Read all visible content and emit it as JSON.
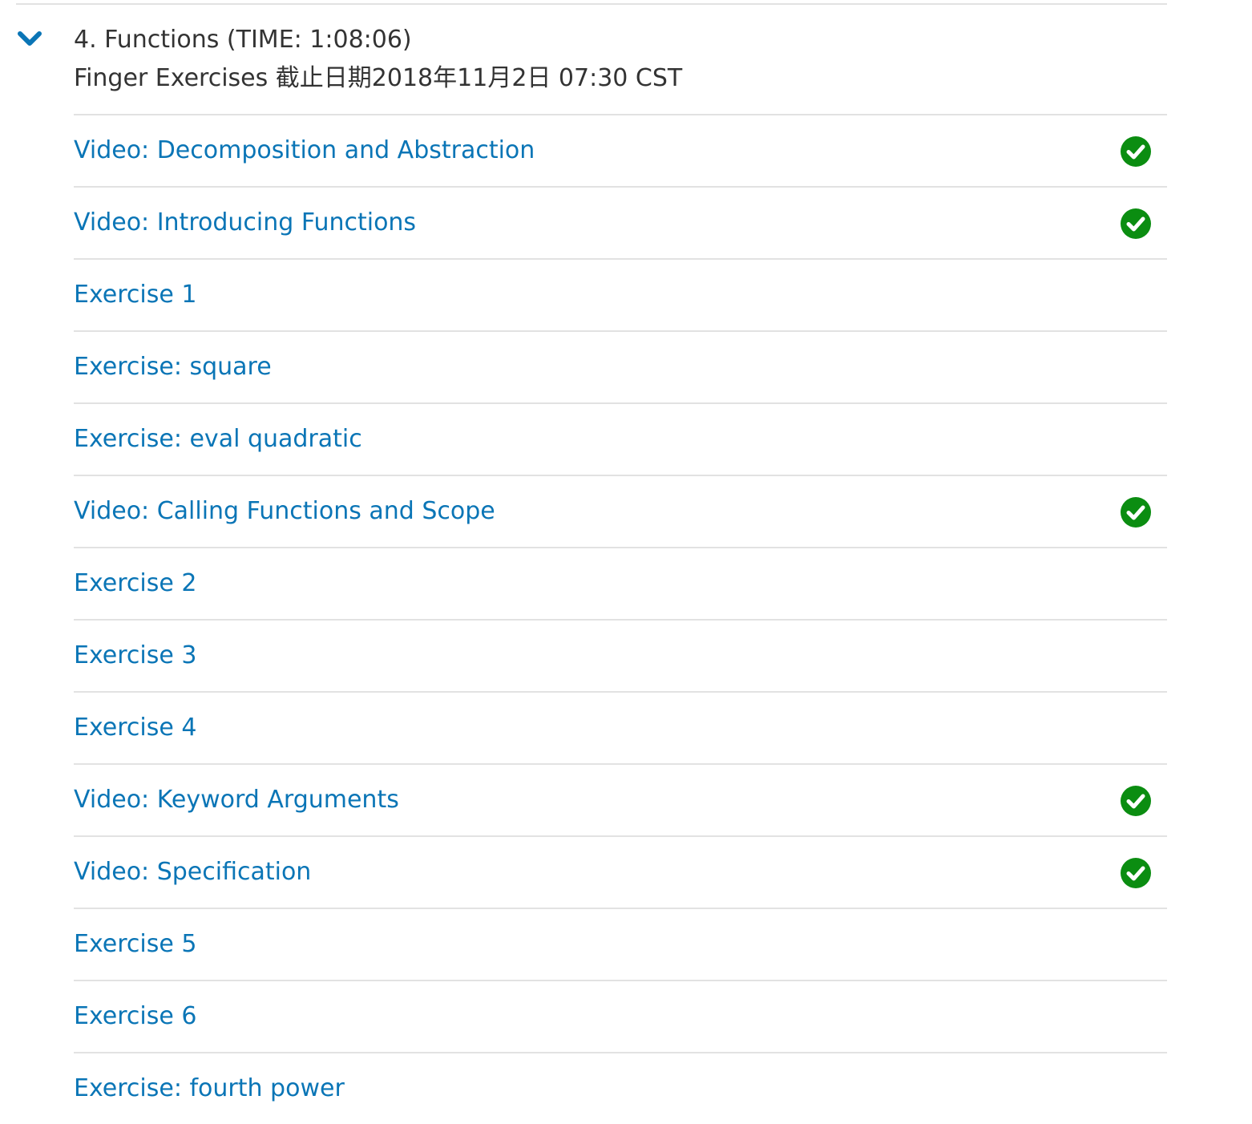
{
  "section": {
    "title": "4. Functions (TIME: 1:08:06)",
    "subtitle": "Finger Exercises 截止日期2018年11月2日 07:30 CST",
    "toggle_icon": "chevron-down-icon",
    "accent_color": "#0a75b6",
    "complete_color": "#0b8d11"
  },
  "items": [
    {
      "label": "Video: Decomposition and Abstraction",
      "completed": true
    },
    {
      "label": "Video: Introducing Functions",
      "completed": true
    },
    {
      "label": "Exercise 1",
      "completed": false
    },
    {
      "label": "Exercise: square",
      "completed": false
    },
    {
      "label": "Exercise: eval quadratic",
      "completed": false
    },
    {
      "label": "Video: Calling Functions and Scope",
      "completed": true
    },
    {
      "label": "Exercise 2",
      "completed": false
    },
    {
      "label": "Exercise 3",
      "completed": false
    },
    {
      "label": "Exercise 4",
      "completed": false
    },
    {
      "label": "Video: Keyword Arguments",
      "completed": true
    },
    {
      "label": "Video: Specification",
      "completed": true
    },
    {
      "label": "Exercise 5",
      "completed": false
    },
    {
      "label": "Exercise 6",
      "completed": false
    },
    {
      "label": "Exercise: fourth power",
      "completed": false
    }
  ]
}
